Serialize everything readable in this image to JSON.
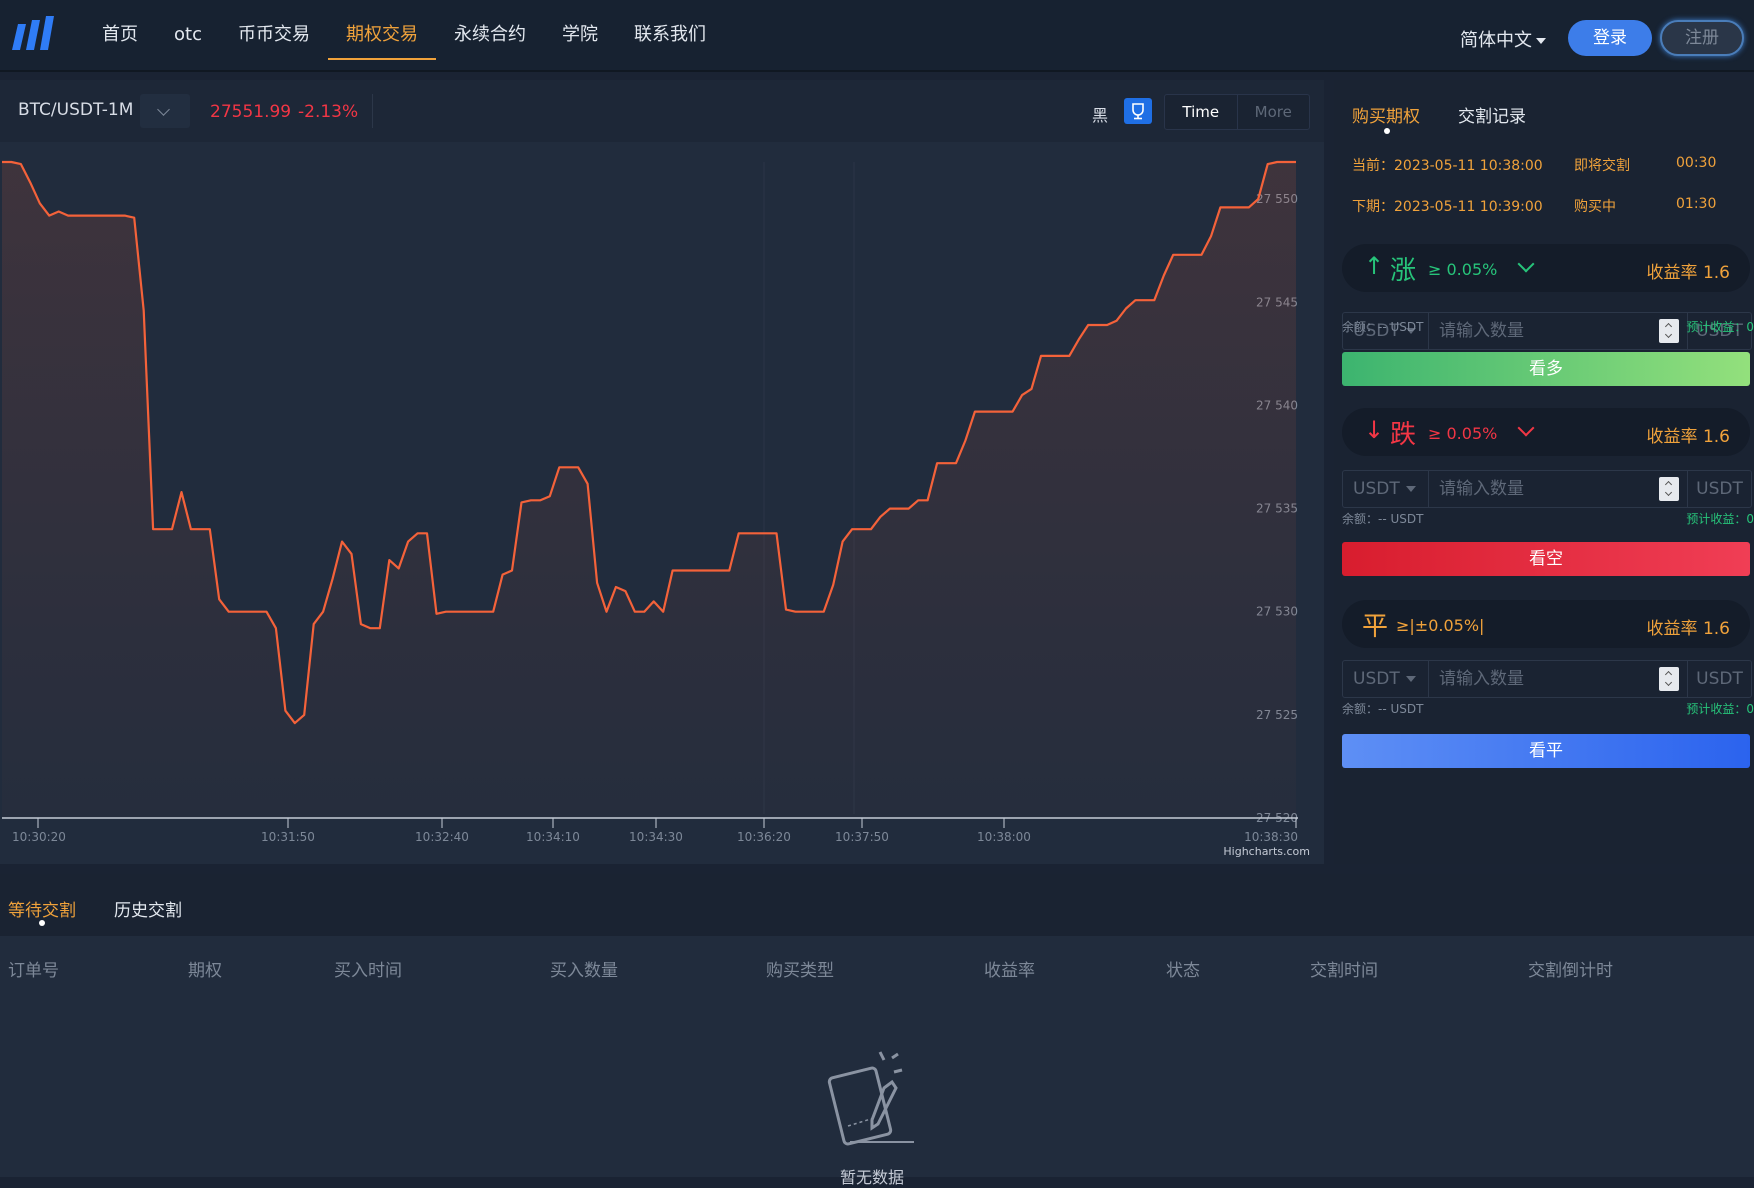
{
  "header": {
    "nav": [
      "首页",
      "otc",
      "币币交易",
      "期权交易",
      "永续合约",
      "学院",
      "联系我们"
    ],
    "active_nav": "期权交易",
    "language": "简体中文",
    "login": "登录",
    "register": "注册"
  },
  "chart_header": {
    "symbol": "BTC/USDT-1M",
    "price": "27551.99",
    "change": "-2.13%",
    "theme_black": "黑",
    "time_btn": "Time",
    "more_btn": "More",
    "credit": "Highcharts.com"
  },
  "chart_data": {
    "type": "line",
    "x_tick_labels": [
      "10:30:20",
      "10:31:50",
      "10:32:40",
      "10:34:10",
      "10:34:30",
      "10:36:20",
      "10:37:50",
      "10:38:00",
      "10:38:30"
    ],
    "y_tick_labels": [
      "27 550",
      "27 545",
      "27 540",
      "27 535",
      "27 530",
      "27 525",
      "27 520"
    ],
    "ylim": [
      27520,
      27551.8
    ],
    "series": [
      {
        "color": "#f4623a",
        "values": [
          27551.8,
          27551.8,
          27551.7,
          27550.8,
          27549.8,
          27549.2,
          27549.4,
          27549.2,
          27549.2,
          27549.2,
          27549.2,
          27549.2,
          27549.2,
          27549.2,
          27549.1,
          27544.6,
          27534.0,
          27534.0,
          27534.0,
          27535.8,
          27534.0,
          27534.0,
          27534.0,
          27530.6,
          27530.0,
          27530.0,
          27530.0,
          27530.0,
          27530.0,
          27529.2,
          27525.2,
          27524.6,
          27525.0,
          27529.4,
          27530.0,
          27531.6,
          27533.4,
          27532.8,
          27529.4,
          27529.2,
          27529.2,
          27532.5,
          27532.1,
          27533.4,
          27533.8,
          27533.8,
          27529.9,
          27530.0,
          27530.0,
          27530.0,
          27530.0,
          27530.0,
          27530.0,
          27531.8,
          27532.0,
          27535.3,
          27535.4,
          27535.4,
          27535.6,
          27537.0,
          27537.0,
          27537.0,
          27536.2,
          27531.4,
          27530.0,
          27531.2,
          27531.0,
          27530.0,
          27530.0,
          27530.5,
          27530.0,
          27532.0,
          27532.0,
          27532.0,
          27532.0,
          27532.0,
          27532.0,
          27532.0,
          27533.8,
          27533.8,
          27533.8,
          27533.8,
          27533.8,
          27530.1,
          27530.0,
          27530.0,
          27530.0,
          27530.0,
          27531.3,
          27533.4,
          27534.0,
          27534.0,
          27534.0,
          27534.6,
          27535.0,
          27535.0,
          27535.0,
          27535.4,
          27535.4,
          27537.2,
          27537.2,
          27537.2,
          27538.3,
          27539.7,
          27539.7,
          27539.7,
          27539.7,
          27539.7,
          27540.5,
          27540.8,
          27542.4,
          27542.4,
          27542.4,
          27542.4,
          27543.2,
          27543.9,
          27543.9,
          27543.9,
          27544.1,
          27544.7,
          27545.1,
          27545.1,
          27545.1,
          27546.3,
          27547.3,
          27547.3,
          27547.3,
          27547.3,
          27548.2,
          27549.6,
          27549.6,
          27549.6,
          27549.6,
          27550.0,
          27551.7,
          27551.8,
          27551.8,
          27551.8
        ]
      }
    ]
  },
  "right_panel": {
    "tabs": [
      "购买期权",
      "交割记录"
    ],
    "current_label": "当前：2023-05-11 10:38:00",
    "current_status": "即将交割",
    "current_countdown": "00:30",
    "next_label": "下期：2023-05-11 10:39:00",
    "next_status": "购买中",
    "next_countdown": "01:30",
    "options": [
      {
        "arrow": "↑",
        "word": "涨",
        "threshold": "≥ 0.05%",
        "rate": "收益率 1.6",
        "unit": "USDT",
        "placeholder": "请输入数量",
        "suffix": "USDT",
        "balance": "余额：-- USDT",
        "estimate": "预计收益：0",
        "action": "看多"
      },
      {
        "arrow": "↓",
        "word": "跌",
        "threshold": "≥ 0.05%",
        "rate": "收益率 1.6",
        "unit": "USDT",
        "placeholder": "请输入数量",
        "suffix": "USDT",
        "balance": "余额：-- USDT",
        "estimate": "预计收益：0",
        "action": "看空"
      },
      {
        "arrow": "",
        "word": "平",
        "threshold": "≥|±0.05%|",
        "rate": "收益率 1.6",
        "unit": "USDT",
        "placeholder": "请输入数量",
        "suffix": "USDT",
        "balance": "余额：-- USDT",
        "estimate": "预计收益：0",
        "action": "看平"
      }
    ]
  },
  "bottom": {
    "tabs": [
      "等待交割",
      "历史交割"
    ],
    "columns": [
      "订单号",
      "期权",
      "买入时间",
      "买入数量",
      "购买类型",
      "收益率",
      "状态",
      "交割时间",
      "交割倒计时"
    ],
    "empty_text": "暂无数据"
  },
  "colors": {
    "accent": "#f0a23b",
    "up": "#27c47a",
    "down": "#f23645",
    "line": "#f4623a",
    "primary": "#3d7de9"
  }
}
